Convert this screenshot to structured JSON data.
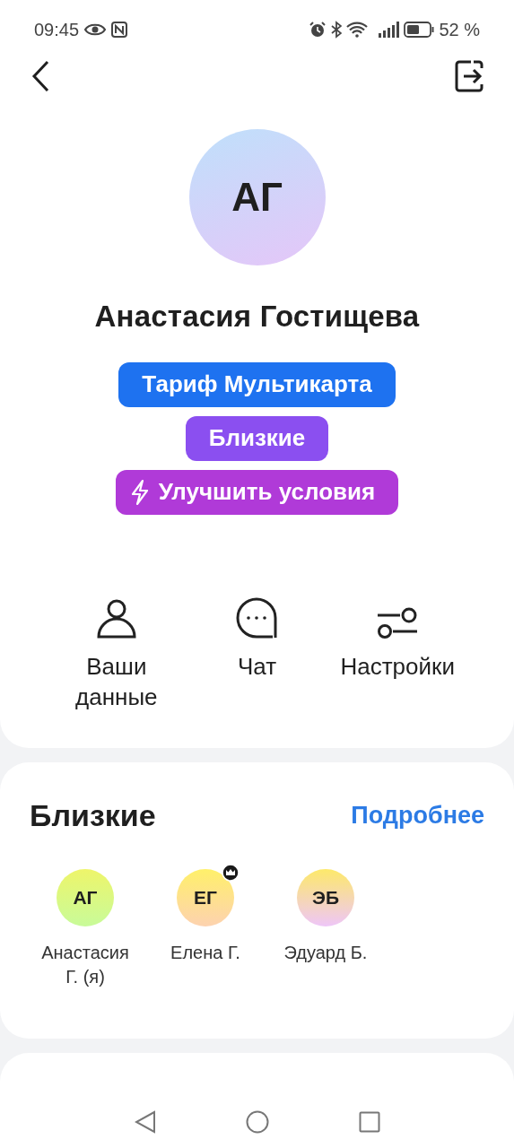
{
  "status_bar": {
    "time": "09:45",
    "battery": "52 %"
  },
  "profile": {
    "initials": "АГ",
    "name": "Анастасия Гостищева"
  },
  "badges": [
    {
      "label": "Тариф Мультикарта",
      "color": "#1e72f0",
      "kind": "plain"
    },
    {
      "label": "Близкие",
      "color": "#8b4ff0",
      "kind": "plain"
    },
    {
      "label": "Улучшить условия",
      "color": "#b03ad8",
      "kind": "bolt"
    }
  ],
  "actions": [
    {
      "label": "Ваши данные",
      "kind": "person"
    },
    {
      "label": "Чат",
      "kind": "chat"
    },
    {
      "label": "Настройки",
      "kind": "sliders"
    }
  ],
  "family": {
    "title": "Близкие",
    "link": "Подробнее",
    "members": [
      {
        "initials": "АГ",
        "name": "Анастасия Г. (я)",
        "owner": false,
        "kind": "lime"
      },
      {
        "initials": "ЕГ",
        "name": "Елена Г.",
        "owner": true,
        "kind": "peach"
      },
      {
        "initials": "ЭБ",
        "name": "Эдуард Б.",
        "owner": false,
        "kind": "pink"
      }
    ]
  }
}
